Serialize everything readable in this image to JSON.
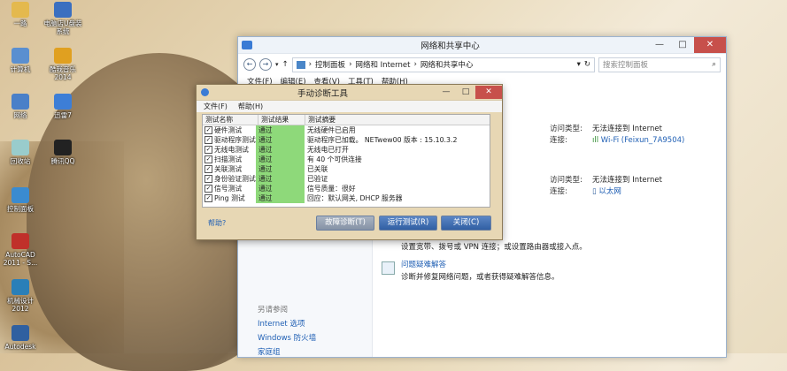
{
  "desktop": {
    "icons": [
      {
        "label": "一路",
        "icon": "folder-icon",
        "color": "#e4b94e"
      },
      {
        "label": "电脑店U盘装\n系统",
        "icon": "usb-tool-icon",
        "color": "#3a6fc0"
      },
      {
        "label": "计算机",
        "icon": "computer-icon",
        "color": "#5a8fd0"
      },
      {
        "label": "酷我音乐\n2014",
        "icon": "music-icon",
        "color": "#e0a020"
      },
      {
        "label": "网络",
        "icon": "network-icon",
        "color": "#4a80c8"
      },
      {
        "label": "迅雷7",
        "icon": "thunder-icon",
        "color": "#3d7ed6"
      },
      {
        "label": "回收站",
        "icon": "recycle-bin-icon",
        "color": "#9cc"
      },
      {
        "label": "腾讯QQ",
        "icon": "qq-icon",
        "color": "#222"
      },
      {
        "label": "控制面板",
        "icon": "control-panel-icon",
        "color": "#3a8bd0"
      },
      {
        "label": "AutoCAD\n2011 - S...",
        "icon": "autocad-icon",
        "color": "#c0302a"
      },
      {
        "label": "机械设计\n2012",
        "icon": "app-icon",
        "color": "#2a7fb8"
      },
      {
        "label": "Autodesk",
        "icon": "autodesk-icon",
        "color": "#3060a0"
      }
    ]
  },
  "window": {
    "title": "网络和共享中心",
    "controls": {
      "min": "—",
      "max": "□",
      "close": "✕"
    },
    "breadcrumb": [
      "控制面板",
      "网络和 Internet",
      "网络和共享中心"
    ],
    "search_placeholder": "搜索控制面板",
    "menu": [
      "文件(F)",
      "编辑(E)",
      "查看(V)",
      "工具(T)",
      "帮助(H)"
    ],
    "networks": [
      {
        "access_label": "访问类型:",
        "access_value": "无法连接到 Internet",
        "conn_label": "连接:",
        "conn_value": "Wi-Fi (Feixun_7A9504)"
      },
      {
        "access_label": "访问类型:",
        "access_value": "无法连接到 Internet",
        "conn_label": "连接:",
        "conn_value": "以太网"
      }
    ],
    "tasks": [
      {
        "title": "",
        "desc": "设置宽带、拨号或 VPN 连接；或设置路由器或接入点。"
      },
      {
        "title": "问题疑难解答",
        "desc": "诊断并修复网络问题，或者获得疑难解答信息。"
      }
    ],
    "see_also": {
      "header": "另请参阅",
      "items": [
        "Internet 选项",
        "Windows 防火墙",
        "家庭组"
      ]
    }
  },
  "dialog": {
    "title": "手动诊断工具",
    "controls": {
      "min": "—",
      "max": "□",
      "close": "✕"
    },
    "menu": [
      "文件(F)",
      "帮助(H)"
    ],
    "columns": [
      "测试名称",
      "测试结果",
      "测试摘要"
    ],
    "rows": [
      {
        "name": "硬件测试",
        "result": "通过",
        "summary": "无线硬件已启用",
        "checked": true
      },
      {
        "name": "驱动程序测试",
        "result": "通过",
        "summary": "驱动程序已加载。 NETwew00 版本 : 15.10.3.2",
        "checked": true
      },
      {
        "name": "无线电测试",
        "result": "通过",
        "summary": "无线电已打开",
        "checked": true
      },
      {
        "name": "扫描测试",
        "result": "通过",
        "summary": "有 40 个可供连接",
        "checked": true
      },
      {
        "name": "关联测试",
        "result": "通过",
        "summary": "已关联",
        "checked": true
      },
      {
        "name": "身份验证测试",
        "result": "通过",
        "summary": "已验证",
        "checked": true
      },
      {
        "name": "信号测试",
        "result": "通过",
        "summary": "信号质量：很好",
        "checked": true
      },
      {
        "name": "Ping 测试",
        "result": "通过",
        "summary": "回应：默认网关, DHCP 服务器",
        "checked": true
      }
    ],
    "help_link": "帮助?",
    "buttons": {
      "diagnose": "故障诊断(T)",
      "run": "运行测试(R)",
      "close": "关闭(C)"
    }
  }
}
